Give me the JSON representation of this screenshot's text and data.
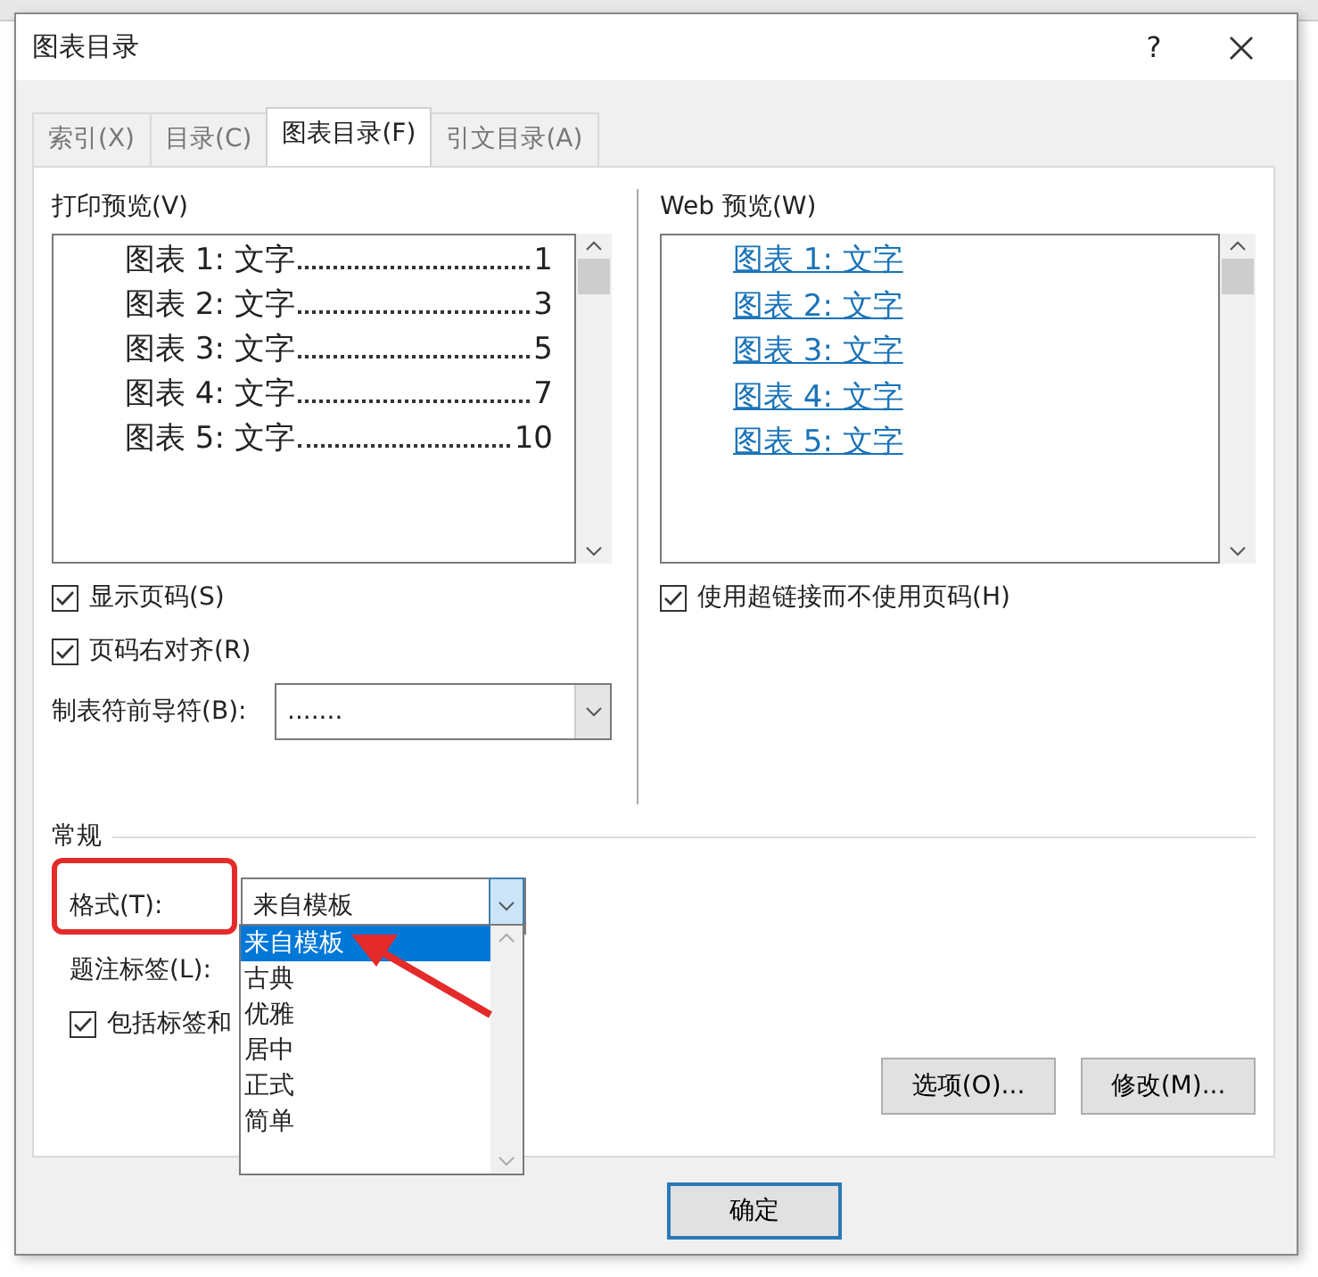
{
  "window": {
    "title": "图表目录",
    "help": "?"
  },
  "tabs": [
    {
      "label": "索引(X)",
      "selected": false
    },
    {
      "label": "目录(C)",
      "selected": false
    },
    {
      "label": "图表目录(F)",
      "selected": true
    },
    {
      "label": "引文目录(A)",
      "selected": false
    }
  ],
  "print_preview": {
    "label": "打印预览(V)",
    "entries": [
      {
        "caption": "图表 1: 文字",
        "page": "1"
      },
      {
        "caption": "图表 2: 文字",
        "page": "3"
      },
      {
        "caption": "图表 3: 文字",
        "page": "5"
      },
      {
        "caption": "图表 4: 文字",
        "page": "7"
      },
      {
        "caption": "图表 5: 文字",
        "page": "10"
      }
    ]
  },
  "show_page_numbers": {
    "label": "显示页码(S)",
    "checked": true
  },
  "right_align": {
    "label": "页码右对齐(R)",
    "checked": true
  },
  "tab_leader": {
    "label": "制表符前导符(B):",
    "value": "......."
  },
  "web_preview": {
    "label": "Web 预览(W)",
    "links": [
      "图表 1: 文字",
      "图表 2: 文字",
      "图表 3: 文字",
      "图表 4: 文字",
      "图表 5: 文字"
    ]
  },
  "use_hyperlinks": {
    "label": "使用超链接而不使用页码(H)",
    "checked": true
  },
  "general": {
    "title": "常规",
    "format": {
      "label": "格式(T):",
      "value": "来自模板",
      "options": [
        {
          "label": "来自模板",
          "selected": true
        },
        {
          "label": "古典",
          "selected": false
        },
        {
          "label": "优雅",
          "selected": false
        },
        {
          "label": "居中",
          "selected": false
        },
        {
          "label": "正式",
          "selected": false
        },
        {
          "label": "简单",
          "selected": false
        }
      ]
    },
    "caption_label": {
      "label": "题注标签(L):"
    },
    "include_label": {
      "label": "包括标签和",
      "checked": true
    }
  },
  "buttons": [
    {
      "label": "选项(O)..."
    },
    {
      "label": "修改(M)..."
    }
  ],
  "ok_button": {
    "label": "确定"
  }
}
